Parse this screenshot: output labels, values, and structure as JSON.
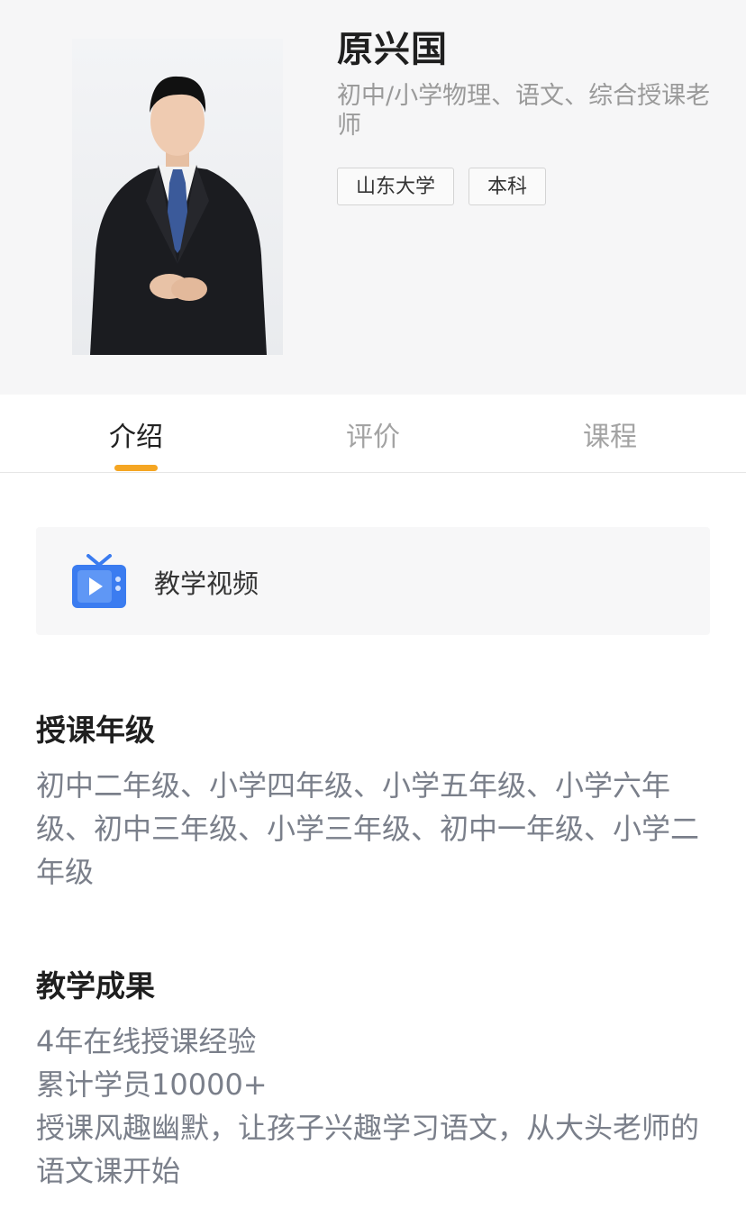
{
  "teacher": {
    "name": "原兴国",
    "subtitle": "初中/小学物理、语文、综合授课老师",
    "tags": [
      "山东大学",
      "本科"
    ]
  },
  "tabs": [
    {
      "label": "介绍",
      "active": true
    },
    {
      "label": "评价",
      "active": false
    },
    {
      "label": "课程",
      "active": false
    }
  ],
  "video": {
    "label": "教学视频",
    "icon": "tv-play-icon"
  },
  "grades": {
    "title": "授课年级",
    "text": "初中二年级、小学四年级、小学五年级、小学六年级、初中三年级、小学三年级、初中一年级、小学二年级"
  },
  "achievements": {
    "title": "教学成果",
    "lines": [
      "4年在线授课经验",
      "累计学员10000+",
      "授课风趣幽默，让孩子兴趣学习语文，从大头老师的语文课开始"
    ]
  },
  "colors": {
    "accent": "#f5a623",
    "icon_blue": "#3b7cf0",
    "muted_text": "#7a7f8a"
  }
}
